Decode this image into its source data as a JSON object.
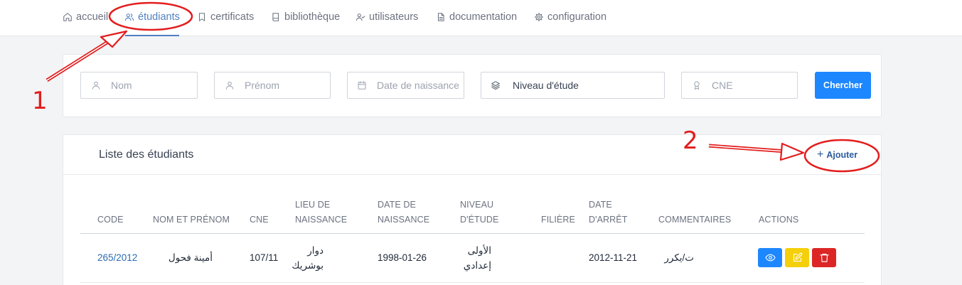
{
  "nav": {
    "items": [
      {
        "label": "accueil",
        "icon": "home-icon"
      },
      {
        "label": "étudiants",
        "icon": "users-icon",
        "active": true
      },
      {
        "label": "certificats",
        "icon": "bookmark-icon"
      },
      {
        "label": "bibliothèque",
        "icon": "book-icon"
      },
      {
        "label": "utilisateurs",
        "icon": "user-check-icon"
      },
      {
        "label": "documentation",
        "icon": "document-icon"
      },
      {
        "label": "configuration",
        "icon": "gear-icon"
      }
    ],
    "accent_color": "#4f80c2"
  },
  "search": {
    "nom_placeholder": "Nom",
    "prenom_placeholder": "Prénom",
    "date_placeholder": "Date de naissance",
    "niveau_selected": "Niveau d'étude",
    "cne_placeholder": "CNE",
    "button_label": "Chercher",
    "button_color": "#1d87ff"
  },
  "list": {
    "title": "Liste des étudiants",
    "add_label": "Ajouter",
    "columns": [
      {
        "line1": "CODE",
        "line2": ""
      },
      {
        "line1": "NOM ET PRÉNOM",
        "line2": ""
      },
      {
        "line1": "CNE",
        "line2": ""
      },
      {
        "line1": "LIEU DE",
        "line2": "NAISSANCE"
      },
      {
        "line1": "DATE DE",
        "line2": "NAISSANCE"
      },
      {
        "line1": "NIVEAU",
        "line2": "D'ÉTUDE"
      },
      {
        "line1": "FILIÈRE",
        "line2": ""
      },
      {
        "line1": "DATE",
        "line2": "D'ARRÊT"
      },
      {
        "line1": "COMMENTAIRES",
        "line2": ""
      },
      {
        "line1": "ACTIONS",
        "line2": ""
      }
    ],
    "rows": [
      {
        "code": "265/2012",
        "nom": "أمينة فحول",
        "cne": "107/11",
        "lieu_line1": "دوار",
        "lieu_line2": "بوشريك",
        "date_naissance": "1998-01-26",
        "niveau_line1": "الأولى",
        "niveau_line2": "إعدادي",
        "filiere": "",
        "date_arret": "2012-11-21",
        "commentaire": "ت/يكرر"
      }
    ],
    "action_icons": [
      "eye-icon",
      "edit-icon",
      "trash-icon"
    ],
    "action_colors": {
      "view": "#1d87ff",
      "edit": "#f5cf0a",
      "delete": "#dc2626"
    }
  },
  "annotations": {
    "marker_1": "1",
    "marker_2": "2",
    "color": "#e31d1d"
  }
}
